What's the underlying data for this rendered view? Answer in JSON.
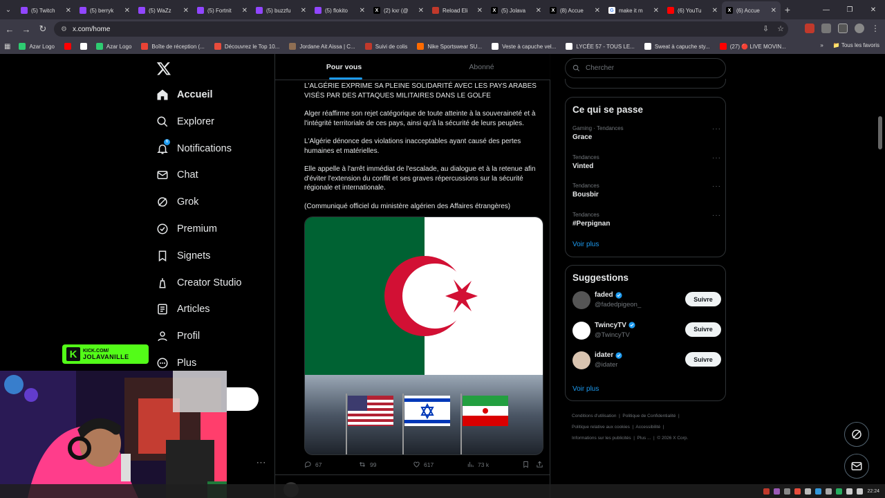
{
  "browser": {
    "tabs": [
      {
        "title": "(5) Twitch",
        "color": "#9146ff",
        "glyph": ""
      },
      {
        "title": "(5) berryk",
        "color": "#9146ff",
        "glyph": ""
      },
      {
        "title": "(5) WaZz",
        "color": "#9146ff",
        "glyph": ""
      },
      {
        "title": "(5) Fortnit",
        "color": "#9146ff",
        "glyph": ""
      },
      {
        "title": "(5) buzzfu",
        "color": "#9146ff",
        "glyph": ""
      },
      {
        "title": "(5) flokito",
        "color": "#9146ff",
        "glyph": ""
      },
      {
        "title": "(2) kxr (@",
        "color": "#000000",
        "glyph": "X"
      },
      {
        "title": "Reload Eli",
        "color": "#c0392b",
        "glyph": ""
      },
      {
        "title": "(5) Jolava",
        "color": "#000000",
        "glyph": "X"
      },
      {
        "title": "(8) Accue",
        "color": "#000000",
        "glyph": "X"
      },
      {
        "title": "make it m",
        "color": "#ffffff",
        "glyph": "G"
      },
      {
        "title": "(6) YouTu",
        "color": "#ff0000",
        "glyph": ""
      },
      {
        "title": "(6) Accue",
        "color": "#000000",
        "glyph": "X"
      }
    ],
    "url": "x.com/home",
    "bookmarks": [
      {
        "label": "Azar Logo",
        "color": "#2ecc71"
      },
      {
        "label": "",
        "color": "#ff0000"
      },
      {
        "label": "",
        "color": "#ffffff"
      },
      {
        "label": "Azar Logo",
        "color": "#2ecc71"
      },
      {
        "label": "Boîte de réception (...",
        "color": "#ea4335"
      },
      {
        "label": "Découvrez le Top 10...",
        "color": "#e74c3c"
      },
      {
        "label": "Jordane Ait Aissa | C...",
        "color": "#8e6e53"
      },
      {
        "label": "Suivi de colis",
        "color": "#c0392b"
      },
      {
        "label": "Nike Sportswear SU...",
        "color": "#ff6b00"
      },
      {
        "label": "Veste à capuche vel...",
        "color": "#ffffff"
      },
      {
        "label": "LYCÉE 57 - TOUS LE...",
        "color": "#ffffff"
      },
      {
        "label": "Sweat à capuche sty...",
        "color": "#ffffff"
      },
      {
        "label": "(27) 🔴 LIVE MOVIN...",
        "color": "#ff0000"
      }
    ],
    "bookmarks_all": "Tous les favoris"
  },
  "nav": {
    "items": [
      {
        "label": "Accueil",
        "icon": "home-icon"
      },
      {
        "label": "Explorer",
        "icon": "search-icon"
      },
      {
        "label": "Notifications",
        "icon": "bell-icon"
      },
      {
        "label": "Chat",
        "icon": "mail-icon"
      },
      {
        "label": "Grok",
        "icon": "grok-icon"
      },
      {
        "label": "Premium",
        "icon": "premium-icon"
      },
      {
        "label": "Signets",
        "icon": "bookmark-icon"
      },
      {
        "label": "Creator Studio",
        "icon": "creator-icon"
      },
      {
        "label": "Articles",
        "icon": "articles-icon"
      },
      {
        "label": "Profil",
        "icon": "profile-icon"
      },
      {
        "label": "Plus",
        "icon": "more-icon"
      }
    ],
    "notif_badge": "6"
  },
  "feed": {
    "tabs": [
      "Pour vous",
      "Abonné"
    ],
    "tweet": {
      "paragraphs": [
        "L'ALGÉRIE EXPRIME SA PLEINE SOLIDARITÉ AVEC LES PAYS ARABES VISÉS PAR DES ATTAQUES MILITAIRES DANS LE GOLFE",
        "Alger réaffirme son rejet catégorique de toute atteinte à la souveraineté et à l'intégrité territoriale de ces pays, ainsi qu'à la sécurité de leurs peuples.",
        "L'Algérie dénonce des violations inacceptables ayant causé des pertes humaines et matérielles.",
        "Elle appelle à l'arrêt immédiat de l'escalade, au dialogue et à la retenue afin d'éviter l'extension du conflit et ses graves répercussions sur la sécurité régionale et internationale.",
        "(Communiqué officiel du ministère algérien des Affaires étrangères)"
      ],
      "replies": "67",
      "reposts": "99",
      "likes": "617",
      "views": "73 k"
    }
  },
  "sidebar": {
    "search_placeholder": "Chercher",
    "trends_title": "Ce qui se passe",
    "trends": [
      {
        "meta": "Gaming · Tendances",
        "name": "Grace"
      },
      {
        "meta": "Tendances",
        "name": "Vinted"
      },
      {
        "meta": "Tendances",
        "name": "Bousbir"
      },
      {
        "meta": "Tendances",
        "name": "#Perpignan"
      }
    ],
    "trends_more": "Voir plus",
    "suggestions_title": "Suggestions",
    "suggestions": [
      {
        "name": "faded",
        "handle": "@fadedpigeon_",
        "button": "Suivre",
        "avatar_color": "#555555"
      },
      {
        "name": "TwincyTV",
        "handle": "@TwincyTV",
        "button": "Suivre",
        "avatar_color": "#ffffff"
      },
      {
        "name": "idater",
        "handle": "@idater",
        "button": "Suivre",
        "avatar_color": "#d9c4b0"
      }
    ],
    "suggestions_more": "Voir plus",
    "footer": [
      "Conditions d'utilisation",
      "Politique de Confidentialité",
      "Politique relative aux cookies",
      "Accessibilité",
      "Informations sur les publicités",
      "Plus ...",
      "© 2026 X Corp."
    ]
  },
  "overlay": {
    "kick_line1": "KICK.COM/",
    "kick_line2": "JOLAVANILLE"
  },
  "taskbar": {
    "time": "22:24"
  },
  "colors": {
    "accent": "#1d9bf0",
    "kick": "#53fc18"
  }
}
